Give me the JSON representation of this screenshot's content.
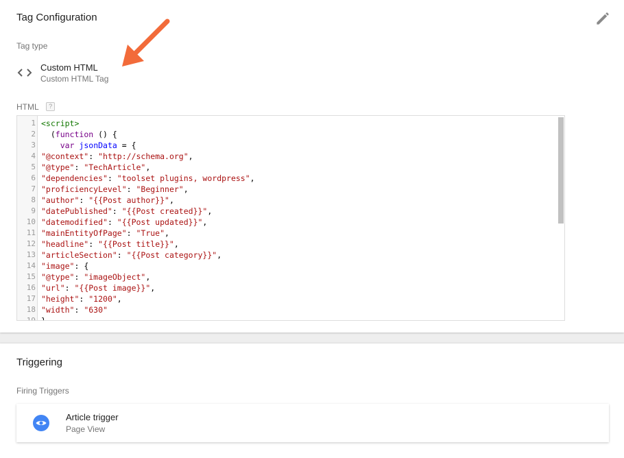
{
  "tag_config": {
    "title": "Tag Configuration",
    "tag_type_label": "Tag type",
    "tag_type_name": "Custom HTML",
    "tag_type_desc": "Custom HTML Tag",
    "html_label": "HTML",
    "help_glyph": "?",
    "edit_icon": "pencil-icon",
    "tag_type_icon": "code-brackets-icon",
    "annotation_color": "#f26b3a",
    "code_lines": [
      [
        {
          "c": "t-tag",
          "t": "<script>"
        }
      ],
      [
        {
          "c": "t-punc",
          "t": "  ("
        },
        {
          "c": "t-kw",
          "t": "function"
        },
        {
          "c": "t-punc",
          "t": " () {"
        }
      ],
      [
        {
          "c": "t-punc",
          "t": "    "
        },
        {
          "c": "t-kw",
          "t": "var"
        },
        {
          "c": "t-punc",
          "t": " "
        },
        {
          "c": "t-def",
          "t": "jsonData"
        },
        {
          "c": "t-punc",
          "t": " = {"
        }
      ],
      [
        {
          "c": "t-str",
          "t": "\"@context\""
        },
        {
          "c": "t-punc",
          "t": ": "
        },
        {
          "c": "t-str",
          "t": "\"http://schema.org\""
        },
        {
          "c": "t-punc",
          "t": ","
        }
      ],
      [
        {
          "c": "t-str",
          "t": "\"@type\""
        },
        {
          "c": "t-punc",
          "t": ": "
        },
        {
          "c": "t-str",
          "t": "\"TechArticle\""
        },
        {
          "c": "t-punc",
          "t": ","
        }
      ],
      [
        {
          "c": "t-str",
          "t": "\"dependencies\""
        },
        {
          "c": "t-punc",
          "t": ": "
        },
        {
          "c": "t-str",
          "t": "\"toolset plugins, wordpress\""
        },
        {
          "c": "t-punc",
          "t": ","
        }
      ],
      [
        {
          "c": "t-str",
          "t": "\"proficiencyLevel\""
        },
        {
          "c": "t-punc",
          "t": ": "
        },
        {
          "c": "t-str",
          "t": "\"Beginner\""
        },
        {
          "c": "t-punc",
          "t": ","
        }
      ],
      [
        {
          "c": "t-str",
          "t": "\"author\""
        },
        {
          "c": "t-punc",
          "t": ": "
        },
        {
          "c": "t-str",
          "t": "\"{{Post author}}\""
        },
        {
          "c": "t-punc",
          "t": ","
        }
      ],
      [
        {
          "c": "t-str",
          "t": "\"datePublished\""
        },
        {
          "c": "t-punc",
          "t": ": "
        },
        {
          "c": "t-str",
          "t": "\"{{Post created}}\""
        },
        {
          "c": "t-punc",
          "t": ","
        }
      ],
      [
        {
          "c": "t-str",
          "t": "\"datemodified\""
        },
        {
          "c": "t-punc",
          "t": ": "
        },
        {
          "c": "t-str",
          "t": "\"{{Post updated}}\""
        },
        {
          "c": "t-punc",
          "t": ","
        }
      ],
      [
        {
          "c": "t-str",
          "t": "\"mainEntityOfPage\""
        },
        {
          "c": "t-punc",
          "t": ": "
        },
        {
          "c": "t-str",
          "t": "\"True\""
        },
        {
          "c": "t-punc",
          "t": ","
        }
      ],
      [
        {
          "c": "t-str",
          "t": "\"headline\""
        },
        {
          "c": "t-punc",
          "t": ": "
        },
        {
          "c": "t-str",
          "t": "\"{{Post title}}\""
        },
        {
          "c": "t-punc",
          "t": ","
        }
      ],
      [
        {
          "c": "t-str",
          "t": "\"articleSection\""
        },
        {
          "c": "t-punc",
          "t": ": "
        },
        {
          "c": "t-str",
          "t": "\"{{Post category}}\""
        },
        {
          "c": "t-punc",
          "t": ","
        }
      ],
      [
        {
          "c": "t-str",
          "t": "\"image\""
        },
        {
          "c": "t-punc",
          "t": ": {"
        }
      ],
      [
        {
          "c": "t-str",
          "t": "\"@type\""
        },
        {
          "c": "t-punc",
          "t": ": "
        },
        {
          "c": "t-str",
          "t": "\"imageObject\""
        },
        {
          "c": "t-punc",
          "t": ","
        }
      ],
      [
        {
          "c": "t-str",
          "t": "\"url\""
        },
        {
          "c": "t-punc",
          "t": ": "
        },
        {
          "c": "t-str",
          "t": "\"{{Post image}}\""
        },
        {
          "c": "t-punc",
          "t": ","
        }
      ],
      [
        {
          "c": "t-str",
          "t": "\"height\""
        },
        {
          "c": "t-punc",
          "t": ": "
        },
        {
          "c": "t-str",
          "t": "\"1200\""
        },
        {
          "c": "t-punc",
          "t": ","
        }
      ],
      [
        {
          "c": "t-str",
          "t": "\"width\""
        },
        {
          "c": "t-punc",
          "t": ": "
        },
        {
          "c": "t-str",
          "t": "\"630\""
        }
      ],
      [
        {
          "c": "t-punc",
          "t": "},"
        }
      ]
    ]
  },
  "triggering": {
    "title": "Triggering",
    "firing_label": "Firing Triggers",
    "trigger_name": "Article trigger",
    "trigger_type": "Page View",
    "trigger_icon": "eye-icon",
    "trigger_icon_color": "#4285f4"
  }
}
